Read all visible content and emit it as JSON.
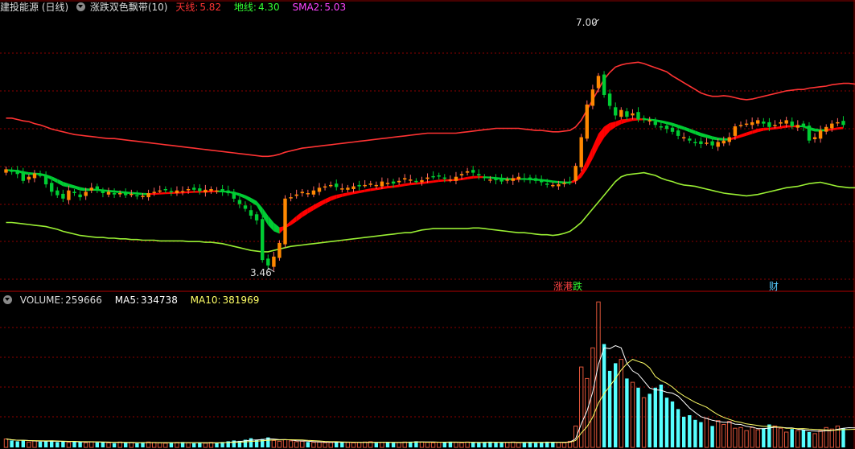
{
  "header": {
    "stock": "建投能源 (日线)",
    "indicator": "涨跌双色飘带(10)",
    "sky_label": "天线:",
    "sky_value": "5.82",
    "ground_label": "地线:",
    "ground_value": "4.30",
    "sma_label": "SMA2:",
    "sma_value": "5.03"
  },
  "volume_header": {
    "volume_label": "VOLUME:",
    "volume_value": "259666",
    "ma5_label": "MA5:",
    "ma5_value": "334738",
    "ma10_label": "MA10:",
    "ma10_value": "381969"
  },
  "annotations": {
    "high": "7.00",
    "low": "3.46"
  },
  "tags": {
    "limit_up": "涨",
    "hk_connect": "港",
    "limit_down": "跌",
    "finance": "财"
  },
  "colors": {
    "sky": "#ff3333",
    "ground": "#33ff33",
    "sma": "#ff44ff",
    "up": "#ff8800",
    "down": "#00cc33",
    "ribbon_up": "#ff0000",
    "ribbon_down": "#00cc33",
    "grid": "#8b0000",
    "vol_up": "#e0553a",
    "vol_down": "#55ffff",
    "ma5": "#ffffff",
    "ma10": "#ffff66"
  },
  "chart_data": {
    "type": "candlestick",
    "price_range": [
      3.2,
      7.2
    ],
    "closes": [
      4.93,
      4.9,
      4.86,
      4.76,
      4.82,
      4.87,
      4.85,
      4.71,
      4.6,
      4.55,
      4.5,
      4.62,
      4.58,
      4.52,
      4.6,
      4.66,
      4.63,
      4.58,
      4.6,
      4.56,
      4.58,
      4.55,
      4.57,
      4.55,
      4.54,
      4.58,
      4.6,
      4.62,
      4.63,
      4.6,
      4.62,
      4.61,
      4.64,
      4.63,
      4.61,
      4.63,
      4.64,
      4.62,
      4.6,
      4.58,
      4.5,
      4.42,
      4.35,
      4.25,
      4.18,
      3.6,
      3.52,
      3.65,
      3.85,
      4.5,
      4.52,
      4.56,
      4.6,
      4.58,
      4.62,
      4.66,
      4.68,
      4.7,
      4.67,
      4.65,
      4.66,
      4.68,
      4.68,
      4.7,
      4.72,
      4.7,
      4.75,
      4.73,
      4.72,
      4.76,
      4.8,
      4.78,
      4.76,
      4.77,
      4.81,
      4.82,
      4.83,
      4.8,
      4.78,
      4.82,
      4.86,
      4.9,
      4.88,
      4.84,
      4.8,
      4.78,
      4.77,
      4.75,
      4.78,
      4.8,
      4.82,
      4.79,
      4.78,
      4.76,
      4.74,
      4.72,
      4.7,
      4.71,
      4.73,
      4.74,
      4.98,
      5.4,
      5.88,
      6.1,
      6.3,
      6.02,
      5.86,
      5.72,
      5.8,
      5.7,
      5.75,
      5.66,
      5.66,
      5.65,
      5.58,
      5.55,
      5.52,
      5.48,
      5.42,
      5.4,
      5.35,
      5.32,
      5.3,
      5.32,
      5.28,
      5.33,
      5.35,
      5.4,
      5.56,
      5.58,
      5.6,
      5.62,
      5.65,
      5.6,
      5.55,
      5.58,
      5.62,
      5.65,
      5.56,
      5.58,
      5.55,
      5.35,
      5.4,
      5.5,
      5.55,
      5.6,
      5.62,
      5.58
    ],
    "volume_range": [
      0,
      1850000
    ],
    "volumes": [
      110000,
      90000,
      80000,
      95000,
      70000,
      85000,
      75000,
      80000,
      90000,
      70000,
      75000,
      65000,
      80000,
      70000,
      60000,
      75000,
      65000,
      70000,
      60000,
      55000,
      70000,
      60000,
      65000,
      55000,
      60000,
      70000,
      65000,
      60000,
      55000,
      60000,
      65000,
      70000,
      60000,
      55000,
      60000,
      55000,
      65000,
      60000,
      70000,
      80000,
      90000,
      85000,
      100000,
      120000,
      95000,
      110000,
      130000,
      90000,
      80000,
      100000,
      85000,
      75000,
      80000,
      70000,
      65000,
      70000,
      60000,
      65000,
      75000,
      70000,
      65000,
      60000,
      65000,
      70000,
      75000,
      60000,
      65000,
      70000,
      60000,
      65000,
      70000,
      75000,
      80000,
      70000,
      65000,
      60000,
      65000,
      70000,
      75000,
      65000,
      60000,
      70000,
      65000,
      60000,
      70000,
      75000,
      65000,
      60000,
      65000,
      70000,
      60000,
      65000,
      70000,
      60000,
      65000,
      75000,
      70000,
      65000,
      60000,
      80000,
      280000,
      1050000,
      900000,
      1300000,
      1900000,
      1350000,
      1000000,
      1100000,
      1150000,
      900000,
      850000,
      780000,
      650000,
      700000,
      780000,
      820000,
      650000,
      600000,
      500000,
      400000,
      420000,
      360000,
      330000,
      380000,
      280000,
      350000,
      300000,
      340000,
      250000,
      260000,
      220000,
      260000,
      230000,
      250000,
      300000,
      280000,
      250000,
      200000,
      240000,
      220000,
      230000,
      200000,
      180000,
      220000,
      260000,
      240000,
      280000,
      250000,
      260000,
      240000,
      230000,
      210000,
      200000,
      220000,
      260000,
      240000,
      259666
    ],
    "sky_line": [
      5.68,
      5.68,
      5.66,
      5.64,
      5.63,
      5.6,
      5.58,
      5.55,
      5.52,
      5.5,
      5.48,
      5.46,
      5.44,
      5.43,
      5.42,
      5.41,
      5.4,
      5.39,
      5.38,
      5.38,
      5.37,
      5.36,
      5.35,
      5.34,
      5.33,
      5.32,
      5.31,
      5.3,
      5.29,
      5.28,
      5.27,
      5.26,
      5.25,
      5.24,
      5.23,
      5.22,
      5.21,
      5.2,
      5.19,
      5.18,
      5.17,
      5.16,
      5.15,
      5.14,
      5.13,
      5.12,
      5.12,
      5.13,
      5.15,
      5.18,
      5.2,
      5.22,
      5.24,
      5.25,
      5.26,
      5.27,
      5.28,
      5.29,
      5.3,
      5.31,
      5.32,
      5.33,
      5.34,
      5.35,
      5.36,
      5.37,
      5.38,
      5.39,
      5.4,
      5.41,
      5.42,
      5.43,
      5.44,
      5.45,
      5.46,
      5.46,
      5.46,
      5.46,
      5.46,
      5.46,
      5.47,
      5.48,
      5.49,
      5.5,
      5.51,
      5.52,
      5.53,
      5.53,
      5.53,
      5.53,
      5.53,
      5.52,
      5.51,
      5.5,
      5.5,
      5.49,
      5.48,
      5.48,
      5.49,
      5.5,
      5.55,
      5.65,
      5.8,
      5.95,
      6.1,
      6.25,
      6.35,
      6.43,
      6.46,
      6.48,
      6.49,
      6.5,
      6.48,
      6.45,
      6.42,
      6.39,
      6.36,
      6.3,
      6.25,
      6.2,
      6.15,
      6.1,
      6.05,
      6.02,
      6.0,
      6.0,
      6.01,
      6.0,
      5.98,
      5.96,
      5.95,
      5.96,
      5.98,
      6.0,
      6.02,
      6.04,
      6.06,
      6.08,
      6.09,
      6.1,
      6.1,
      6.12,
      6.13,
      6.14,
      6.15,
      6.17,
      6.18,
      6.19,
      6.19,
      6.18,
      6.17,
      6.18
    ],
    "ground_line": [
      4.15,
      4.15,
      4.14,
      4.13,
      4.12,
      4.11,
      4.1,
      4.09,
      4.07,
      4.05,
      4.02,
      4.0,
      3.98,
      3.96,
      3.95,
      3.94,
      3.93,
      3.93,
      3.92,
      3.92,
      3.91,
      3.91,
      3.9,
      3.9,
      3.89,
      3.89,
      3.89,
      3.88,
      3.88,
      3.88,
      3.88,
      3.88,
      3.87,
      3.87,
      3.87,
      3.86,
      3.86,
      3.85,
      3.84,
      3.82,
      3.8,
      3.78,
      3.76,
      3.74,
      3.73,
      3.72,
      3.72,
      3.74,
      3.76,
      3.78,
      3.8,
      3.81,
      3.82,
      3.83,
      3.84,
      3.85,
      3.86,
      3.87,
      3.88,
      3.89,
      3.9,
      3.91,
      3.92,
      3.93,
      3.94,
      3.95,
      3.96,
      3.97,
      3.98,
      3.99,
      4.0,
      4.0,
      4.02,
      4.04,
      4.05,
      4.06,
      4.06,
      4.06,
      4.06,
      4.06,
      4.06,
      4.06,
      4.07,
      4.07,
      4.06,
      4.05,
      4.04,
      4.03,
      4.02,
      4.01,
      4.0,
      4.0,
      3.99,
      3.98,
      3.97,
      3.97,
      3.96,
      3.97,
      3.99,
      4.02,
      4.08,
      4.15,
      4.25,
      4.35,
      4.45,
      4.55,
      4.65,
      4.75,
      4.82,
      4.85,
      4.86,
      4.87,
      4.88,
      4.86,
      4.84,
      4.8,
      4.77,
      4.75,
      4.72,
      4.7,
      4.69,
      4.68,
      4.66,
      4.64,
      4.62,
      4.6,
      4.58,
      4.57,
      4.56,
      4.55,
      4.54,
      4.55,
      4.56,
      4.58,
      4.6,
      4.62,
      4.64,
      4.66,
      4.67,
      4.68,
      4.7,
      4.72,
      4.73,
      4.74,
      4.72,
      4.7,
      4.68,
      4.67,
      4.66,
      4.66,
      4.67,
      4.68
    ]
  }
}
